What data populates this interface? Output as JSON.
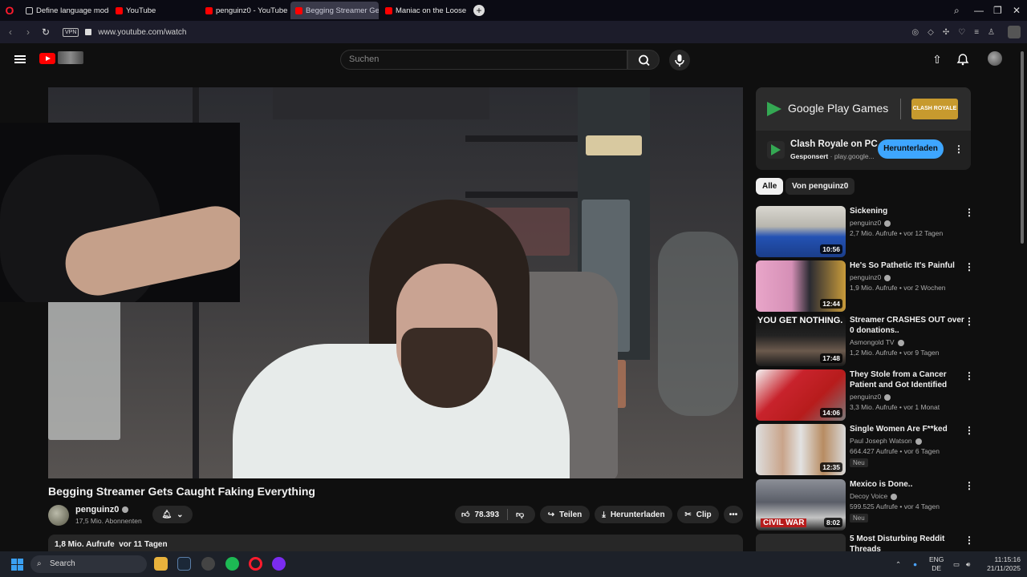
{
  "browser": {
    "tabs": [
      {
        "label": "Define language model",
        "icon": "chatgpt-icon",
        "active": false
      },
      {
        "label": "YouTube",
        "icon": "youtube-icon",
        "active": false
      },
      {
        "label": "penguinz0 - YouTube",
        "icon": "youtube-icon",
        "active": false
      },
      {
        "label": "Begging Streamer Get",
        "icon": "youtube-icon",
        "active": true
      },
      {
        "label": "Maniac on the Loose - Yo",
        "icon": "youtube-icon",
        "active": false
      }
    ],
    "new_tab": "+",
    "vpn_label": "VPN",
    "url": "www.youtube.com/watch"
  },
  "youtube": {
    "search_placeholder": "Suchen",
    "video": {
      "title": "Begging Streamer Gets Caught Faking Everything",
      "channel": "penguinz0",
      "subscribers": "17,5 Mio. Abonnenten",
      "likes": "78.393",
      "share_label": "Teilen",
      "download_label": "Herunterladen",
      "clip_label": "Clip",
      "views": "1,8 Mio. Aufrufe",
      "age": "vor 11 Tagen"
    },
    "ad": {
      "brand": "Google Play Games",
      "game_logo": "CLASH ROYALE",
      "title": "Clash Royale on PC",
      "sponsored": "Gesponsert",
      "domain": "play.google...",
      "button": "Herunterladen"
    },
    "chips": [
      "Alle",
      "Von penguinz0"
    ],
    "recommended": [
      {
        "title": "Sickening",
        "channel": "penguinz0",
        "meta": "2,7 Mio. Aufrufe • vor 12 Tagen",
        "duration": "10:56",
        "badge": ""
      },
      {
        "title": "He's So Pathetic It's Painful",
        "channel": "penguinz0",
        "meta": "1,9 Mio. Aufrufe • vor 2 Wochen",
        "duration": "12:44",
        "badge": ""
      },
      {
        "title": "Streamer CRASHES OUT over 0 donations..",
        "channel": "Asmongold TV",
        "meta": "1,2 Mio. Aufrufe • vor 9 Tagen",
        "duration": "17:48",
        "badge": "",
        "thumb_text": "YOU GET NOTHING."
      },
      {
        "title": "They Stole from a Cancer Patient and Got Identified",
        "channel": "penguinz0",
        "meta": "3,3 Mio. Aufrufe • vor 1 Monat",
        "duration": "14:06",
        "badge": ""
      },
      {
        "title": "Single Women Are F**ked",
        "channel": "Paul Joseph Watson",
        "meta": "664.427 Aufrufe • vor 6 Tagen",
        "duration": "12:35",
        "badge": "Neu"
      },
      {
        "title": "Mexico is Done..",
        "channel": "Decoy Voice",
        "meta": "599.525 Aufrufe • vor 4 Tagen",
        "duration": "8:02",
        "badge": "Neu",
        "thumb_text": "CIVIL WAR"
      },
      {
        "title": "5 Most Disturbing Reddit Threads",
        "channel": "",
        "meta": "",
        "duration": "",
        "badge": ""
      }
    ]
  },
  "taskbar": {
    "search_label": "Search",
    "lang_top": "ENG",
    "lang_bottom": "DE",
    "time": "11:15:16",
    "date": "21/11/2025"
  }
}
